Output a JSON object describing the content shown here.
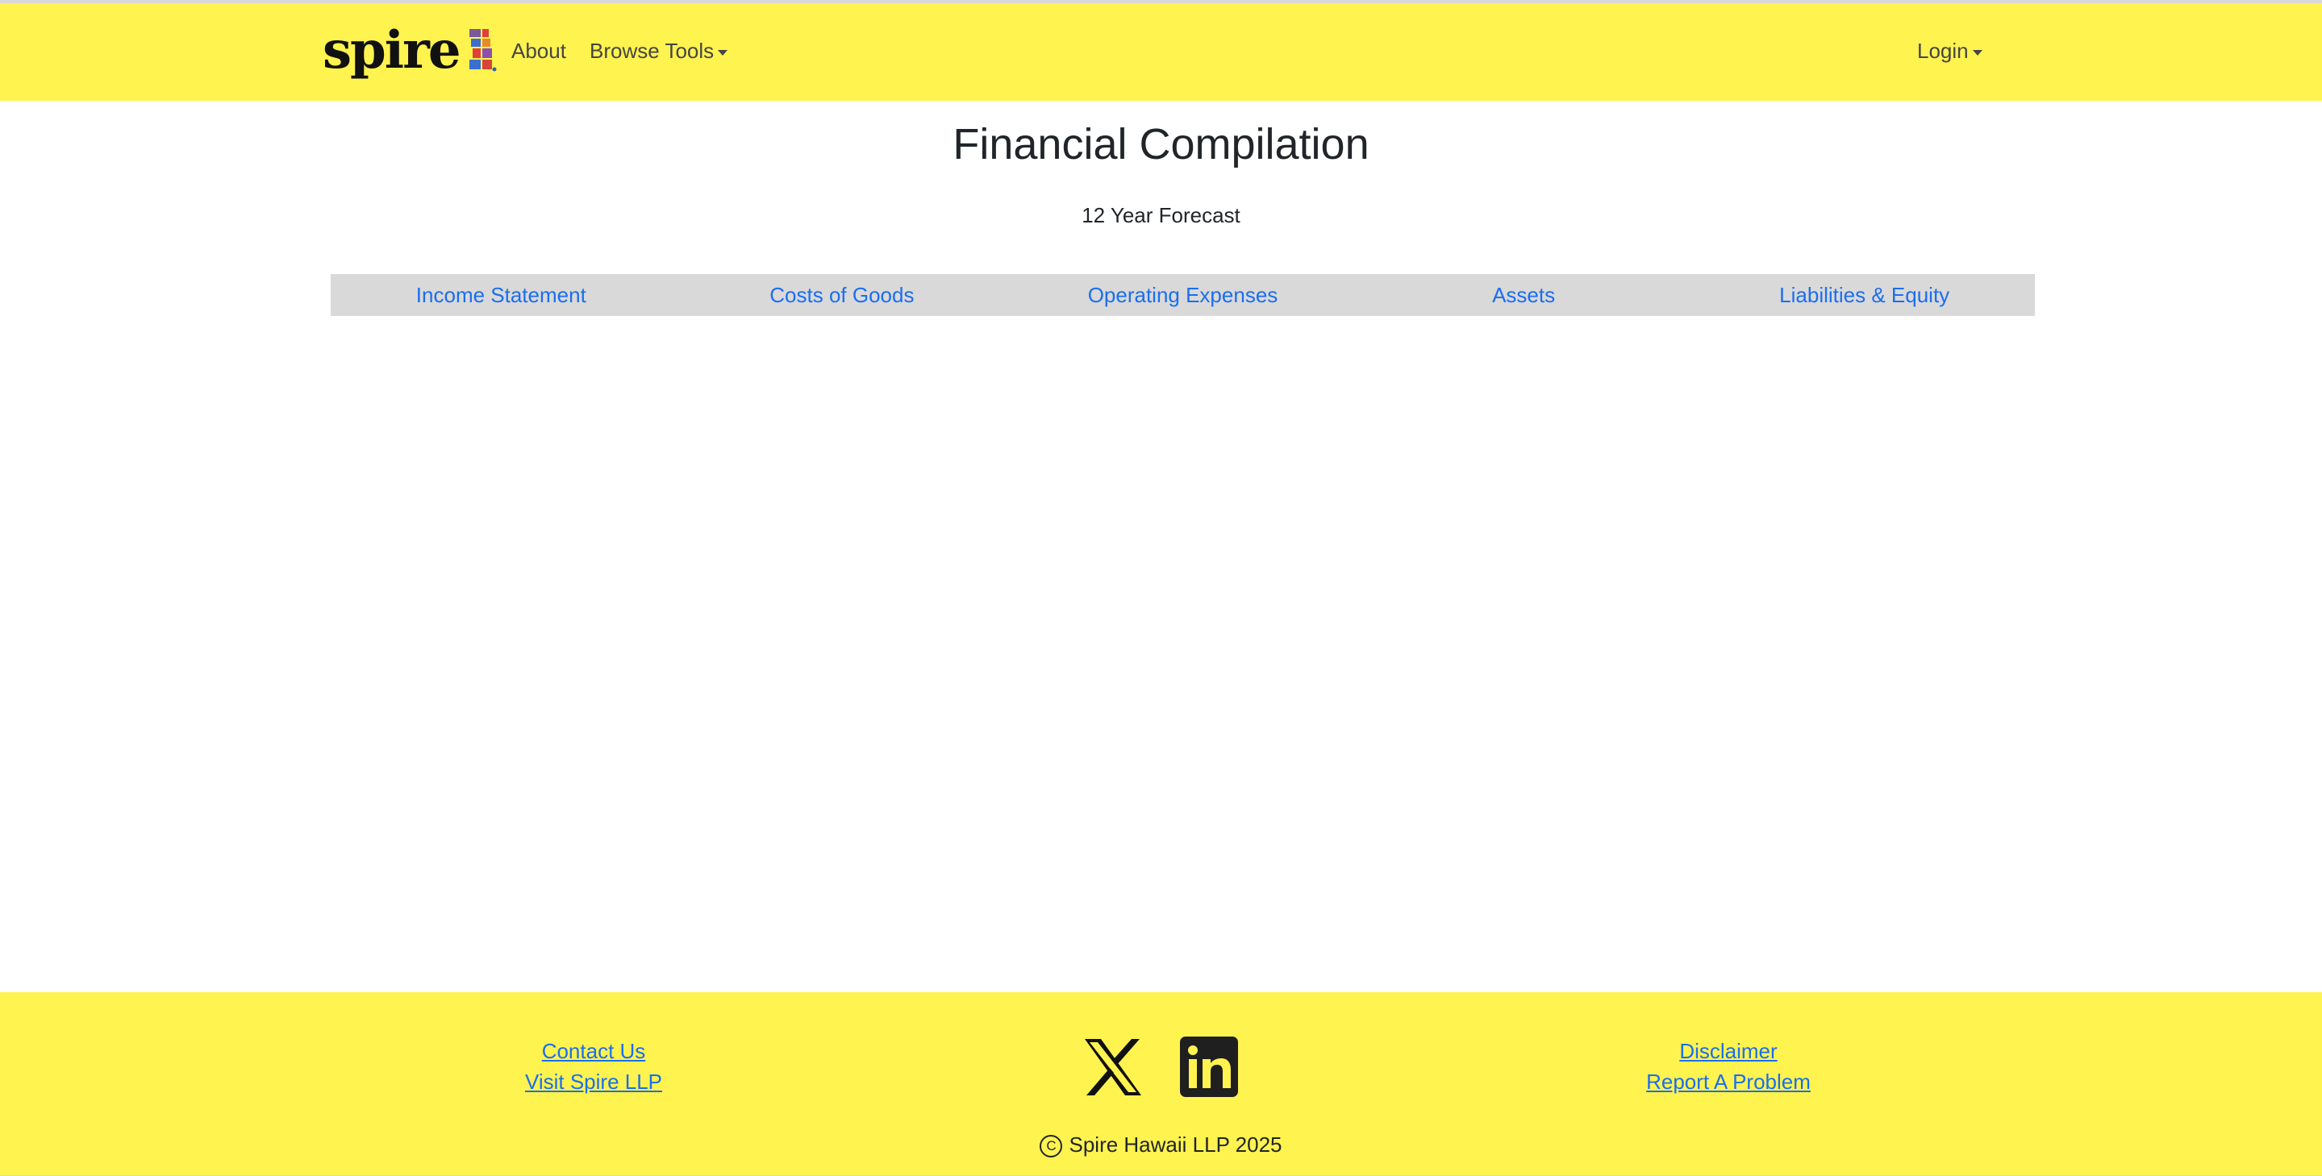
{
  "colors": {
    "brand_yellow": "#fff34f",
    "link_blue": "#1a6ef0",
    "tab_bar_gray": "#d9d9d9",
    "text_dark": "#212529"
  },
  "header": {
    "logo_text": "spire",
    "nav": {
      "about": "About",
      "browse_tools": "Browse Tools",
      "login": "Login"
    }
  },
  "main": {
    "title": "Financial Compilation",
    "subtitle": "12 Year Forecast",
    "tabs": [
      {
        "label": "Income Statement"
      },
      {
        "label": "Costs of Goods"
      },
      {
        "label": "Operating Expenses"
      },
      {
        "label": "Assets"
      },
      {
        "label": "Liabilities & Equity"
      }
    ]
  },
  "footer": {
    "left_links": {
      "contact": "Contact Us",
      "visit": "Visit Spire LLP"
    },
    "right_links": {
      "disclaimer": "Disclaimer",
      "report": "Report A Problem"
    },
    "social": {
      "x_icon": "x-logo-icon",
      "linkedin_icon": "linkedin-icon"
    },
    "copyright_symbol": "C",
    "copyright_text": "Spire Hawaii LLP 2025"
  }
}
